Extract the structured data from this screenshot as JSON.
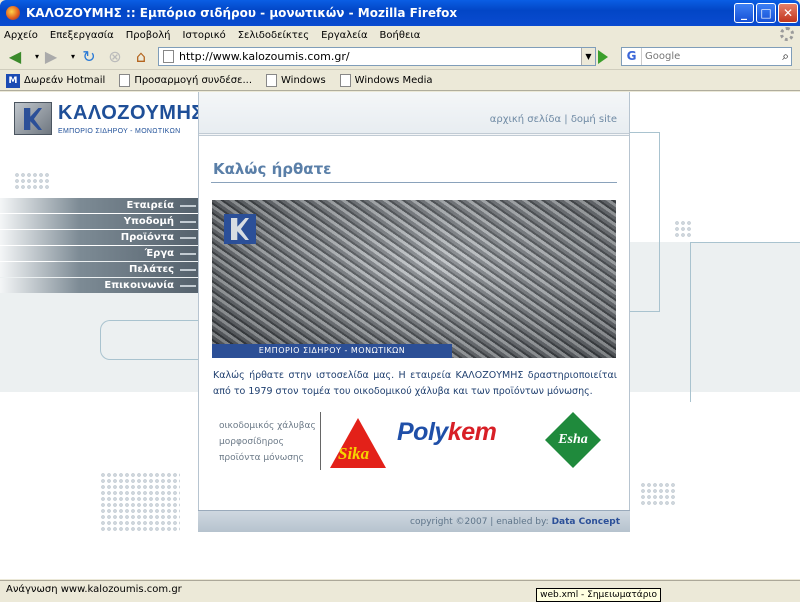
{
  "window": {
    "title": "ΚΑΛΟΖΟΥΜΗΣ :: Εμπόριο σιδήρου - μονωτικών - Mozilla Firefox"
  },
  "menu": [
    "Αρχείο",
    "Επεξεργασία",
    "Προβολή",
    "Ιστορικό",
    "Σελιδοδείκτες",
    "Εργαλεία",
    "Βοήθεια"
  ],
  "address": {
    "url": "http://www.kalozoumis.com.gr/"
  },
  "search": {
    "engine_letter": "G",
    "placeholder": "Google"
  },
  "bookmarks": [
    {
      "label": "Δωρεάν Hotmail"
    },
    {
      "label": "Προσαρμογή συνδέσε..."
    },
    {
      "label": "Windows"
    },
    {
      "label": "Windows Media"
    }
  ],
  "site": {
    "logo_name": "ΚΑΛΟΖΟΥΜΗΣ",
    "logo_sub": "ΕΜΠΟΡΙΟ ΣΙΔΗΡΟΥ - ΜΟΝΩΤΙΚΩΝ",
    "nav": [
      "Εταιρεία",
      "Υποδομή",
      "Προϊόντα",
      "Έργα",
      "Πελάτες",
      "Επικοινωνία"
    ],
    "top_links": {
      "home": "αρχική σελίδα",
      "separator": "|",
      "sitemap": "δομή site"
    },
    "heading": "Καλώς ήρθατε",
    "banner_caption": "ΕΜΠΟΡΙΟ ΣΙΔΗΡΟΥ - ΜΟΝΩΤΙΚΩΝ",
    "intro": "Καλώς ήρθατε στην ιστοσελίδα μας. Η εταιρεία ΚΑΛΟΖΟΥΜΗΣ δραστηριοποιείται από το 1979 στον τομέα του οικοδομικού χάλυβα και των προϊόντων μόνωσης.",
    "products": [
      "οικοδομικός χάλυβας",
      "μορφοσίδηρος",
      "προϊόντα μόνωσης"
    ],
    "partners": {
      "sika": "Sika",
      "polykem_a": "Poly",
      "polykem_b": "kem",
      "esha": "Esha"
    },
    "footer": {
      "copyright": "copyright ©2007 | enabled by:",
      "brand": "Data Concept"
    }
  },
  "status": {
    "text": "Ανάγνωση www.kalozoumis.com.gr",
    "tooltip": "web.xml - Σημειωματάριο"
  }
}
